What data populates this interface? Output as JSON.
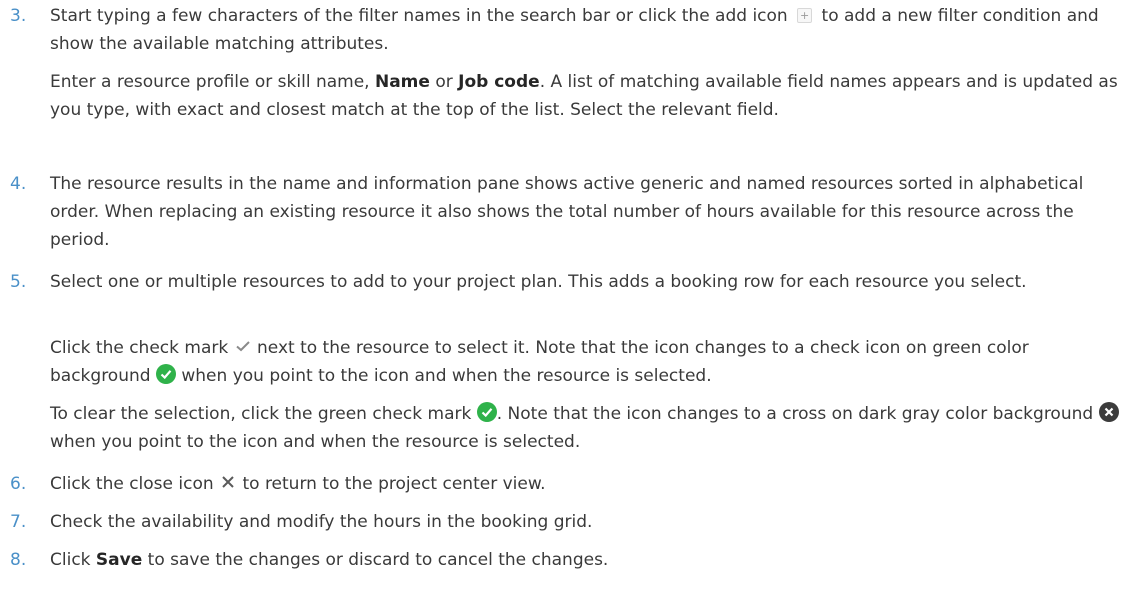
{
  "steps": [
    {
      "number": "3.",
      "paragraphs": [
        {
          "a": "Start typing a few characters of the filter names in the search bar or click the add icon",
          "b": "to add a new filter condition and show the available matching attributes."
        },
        {
          "a": "Enter a resource profile or skill name,",
          "bold1": "Name",
          "mid": "or",
          "bold2": "Job code",
          "b": ". A list of matching available field names appears and is updated as you type, with exact and closest match at the top of the list. Select the relevant field."
        }
      ]
    },
    {
      "number": "4.",
      "paragraphs": [
        {
          "a": "The resource results in the name and information pane shows active generic and named resources sorted in alphabetical order. When replacing an existing resource it also shows the total number of hours available for this resource across the period."
        }
      ]
    },
    {
      "number": "5.",
      "paragraphs": [
        {
          "a": "Select one or multiple resources to add to your project plan. This adds a booking row for each resource you select."
        },
        {
          "a": "Click the check mark",
          "b": "next to the resource to select it. Note that the icon changes to a check icon on green color background",
          "c": "when you point to the icon and when the resource is selected."
        },
        {
          "a": "To clear the selection, click the green check mark",
          "b": ". Note that the icon changes to a cross on dark gray color background",
          "c": "when you point to the icon and when the resource is selected."
        }
      ]
    },
    {
      "number": "6.",
      "paragraphs": [
        {
          "a": "Click the close icon",
          "b": "to return to the project center view."
        }
      ]
    },
    {
      "number": "7.",
      "paragraphs": [
        {
          "a": "Check the availability and modify the hours in the booking grid."
        }
      ]
    },
    {
      "number": "8.",
      "paragraphs": [
        {
          "a": "Click",
          "bold1": "Save",
          "b": "to save the changes or discard to cancel the changes."
        }
      ]
    }
  ],
  "colors": {
    "step_number": "#4a90c8",
    "body_text": "#3a3a3a",
    "check_green": "#2fb24a",
    "cross_dark": "#3c3c3c"
  },
  "icons": [
    "add-icon",
    "check-mark-icon",
    "green-check-icon",
    "dark-cross-icon",
    "close-icon"
  ]
}
